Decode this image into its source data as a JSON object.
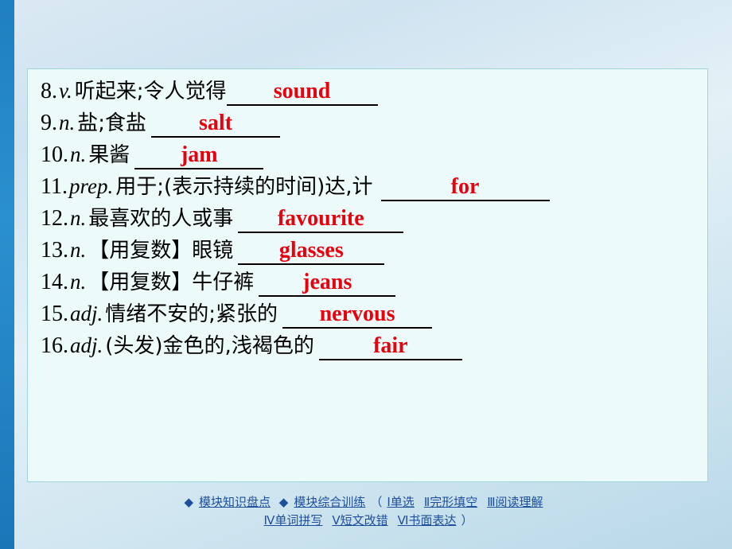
{
  "slide": {
    "entries": [
      {
        "num": "8.",
        "pos": "v.",
        "cn": "听起来;令人觉得",
        "answer": "sound",
        "blank_width": 178
      },
      {
        "num": "9.",
        "pos": "n.",
        "cn": "盐;食盐",
        "answer": "salt",
        "blank_width": 150
      },
      {
        "num": "10.",
        "pos": "n.",
        "cn": "果酱",
        "answer": "jam",
        "blank_width": 150
      },
      {
        "num": "11.",
        "pos": "prep.",
        "cn": "用于;(表示持续的时间)达,计",
        "answer": "for",
        "blank_width": 200
      },
      {
        "num": "12.",
        "pos": "n.",
        "cn": "最喜欢的人或事",
        "answer": "favourite",
        "blank_width": 196
      },
      {
        "num": "13.",
        "pos": "n.",
        "cn": "【用复数】眼镜",
        "answer": "glasses",
        "blank_width": 172
      },
      {
        "num": "14.",
        "pos": "n.",
        "cn": "【用复数】牛仔裤",
        "answer": "jeans",
        "blank_width": 160
      },
      {
        "num": "15.",
        "pos": "adj.",
        "cn": "情绪不安的;紧张的",
        "answer": "nervous",
        "blank_width": 176
      },
      {
        "num": "16.",
        "pos": "adj.",
        "cn": "(头发)金色的,浅褐色的",
        "answer": "fair",
        "blank_width": 168
      }
    ]
  },
  "footer": {
    "row1": {
      "diamond": "◆",
      "item1": "模块知识盘点",
      "diamond2": "◆",
      "item2": "模块综合训练",
      "paren_open": "（",
      "item3": "Ⅰ单选",
      "item4": "Ⅱ完形填空",
      "item5": "Ⅲ阅读理解"
    },
    "row2": {
      "item6": "Ⅳ单词拼写",
      "item7": "Ⅴ短文改错",
      "item8": "Ⅵ书面表达",
      "paren_close": "）"
    }
  }
}
